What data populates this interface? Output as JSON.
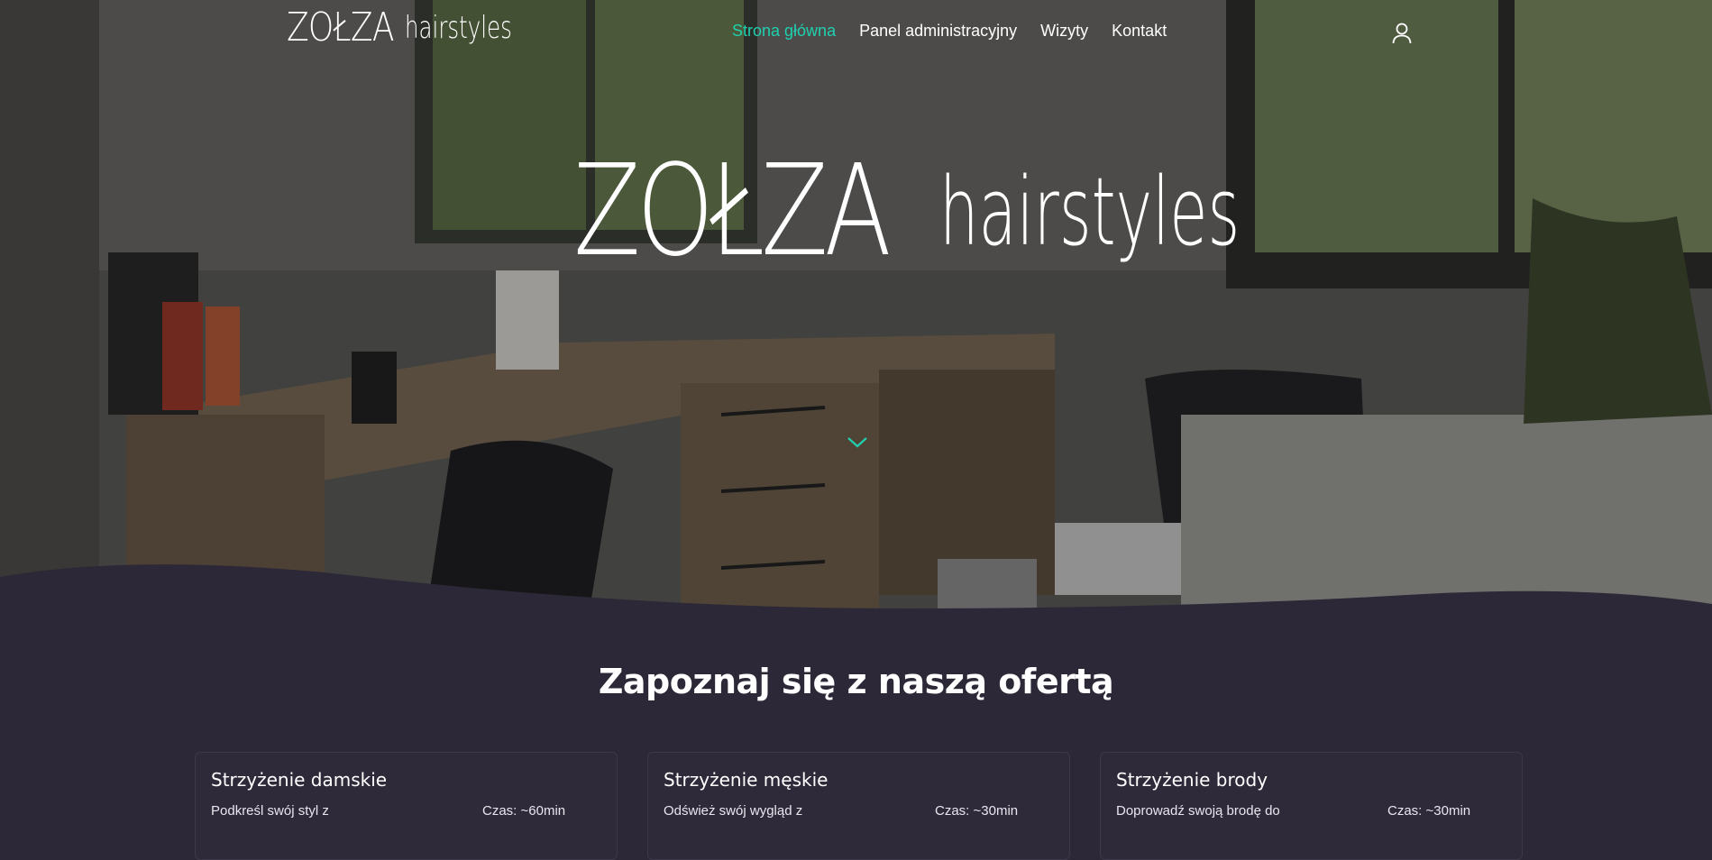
{
  "brand": {
    "main": "ZOŁZA",
    "sub": "hairstyles"
  },
  "nav": {
    "items": [
      {
        "label": "Strona główna",
        "active": true
      },
      {
        "label": "Panel administracyjny",
        "active": false
      },
      {
        "label": "Wizyty",
        "active": false
      },
      {
        "label": "Kontakt",
        "active": false
      }
    ],
    "user_icon": "user-icon",
    "active_color": "#1fd1b0"
  },
  "hero": {
    "logo_main": "ZOŁZA",
    "logo_sub": "hairstyles",
    "scroll_icon": "chevron-down-icon"
  },
  "offer": {
    "title": "Zapoznaj się z naszą ofertą",
    "cards": [
      {
        "title": "Strzyżenie damskie",
        "desc": "Podkreśl swój styl z",
        "time": "Czas: ~60min"
      },
      {
        "title": "Strzyżenie męskie",
        "desc": "Odśwież swój wygląd z",
        "time": "Czas: ~30min"
      },
      {
        "title": "Strzyżenie brody",
        "desc": "Doprowadź swoją brodę do",
        "time": "Czas: ~30min"
      }
    ]
  },
  "colors": {
    "section_bg": "#2d2837",
    "accent": "#1fd1b0"
  }
}
